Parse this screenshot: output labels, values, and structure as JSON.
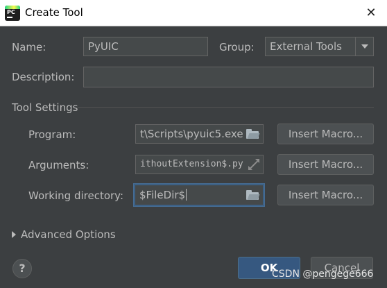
{
  "window": {
    "title": "Create Tool",
    "close_glyph": "✕",
    "app_icon": "pycharm-icon",
    "app_icon_letters": "PC"
  },
  "form": {
    "name_label": "Name:",
    "name_value": "PyUIC",
    "group_label": "Group:",
    "group_value": "External Tools",
    "description_label": "Description:",
    "description_value": ""
  },
  "tool_settings": {
    "section_label": "Tool Settings",
    "program_label": "Program:",
    "program_value": "t\\Scripts\\pyuic5.exe",
    "arguments_label": "Arguments:",
    "arguments_value": "ithoutExtension$.py",
    "working_dir_label": "Working directory:",
    "working_dir_value": "$FileDir$",
    "insert_macro_label": "Insert Macro..."
  },
  "advanced": {
    "label": "Advanced Options"
  },
  "footer": {
    "help_glyph": "?",
    "ok_label": "OK",
    "cancel_label": "Cancel"
  },
  "watermark": {
    "text": "CSDN @pengege666"
  },
  "colors": {
    "background": "#3c3f41",
    "field_background": "#45494a",
    "text": "#bbbbbb",
    "ok_button": "#365880",
    "focus_border": "#3d6185"
  }
}
